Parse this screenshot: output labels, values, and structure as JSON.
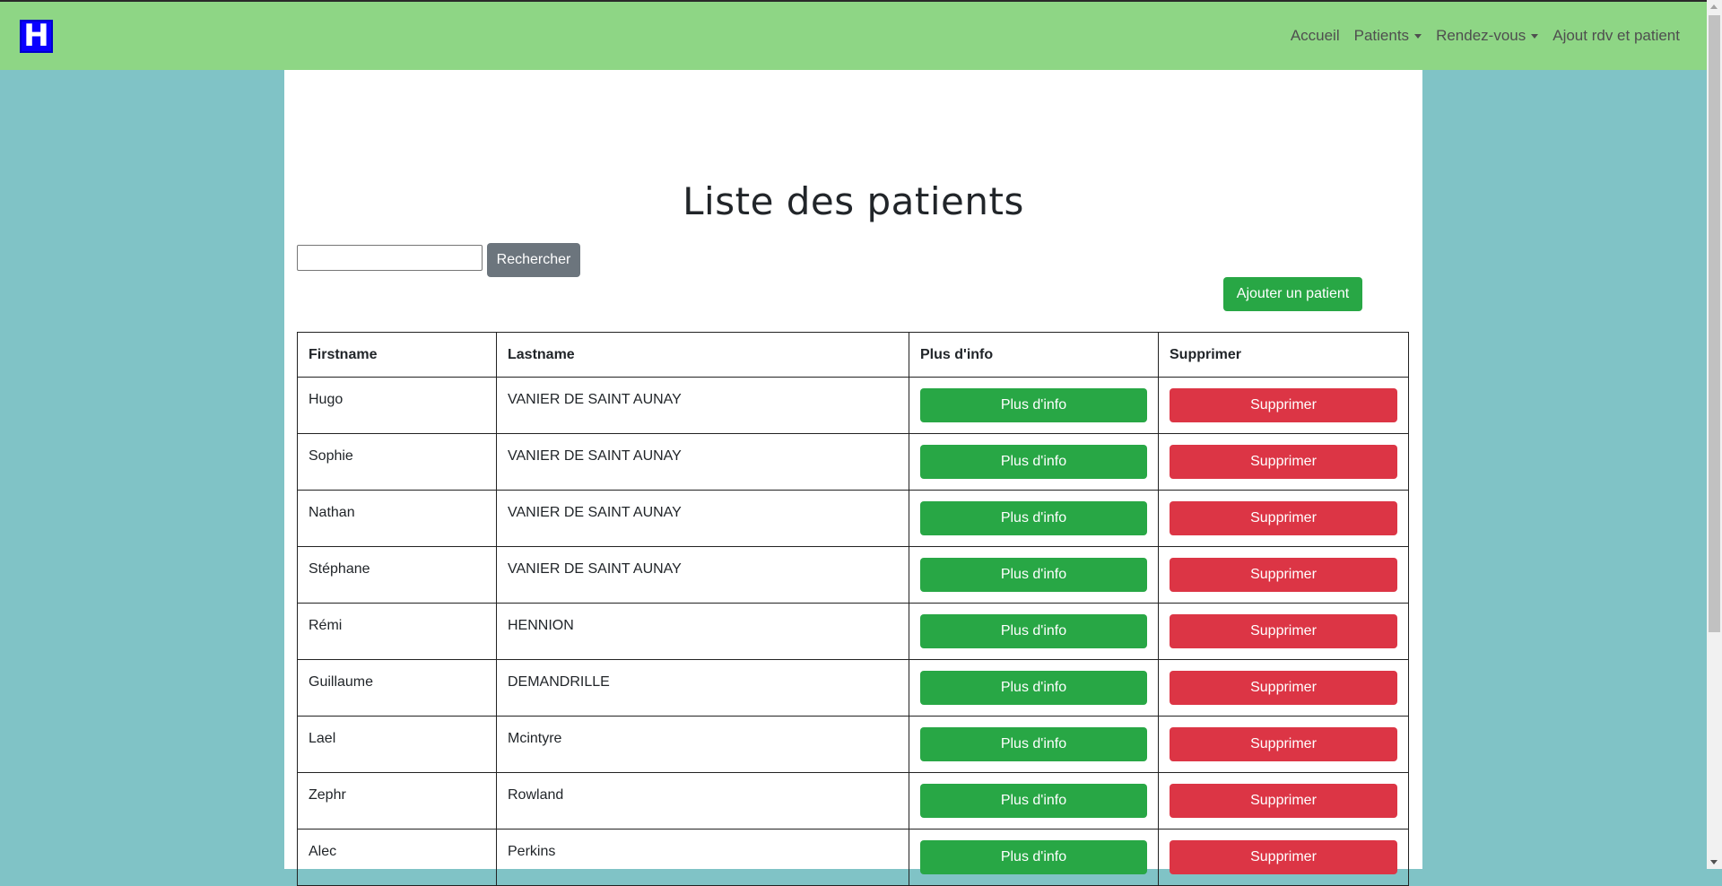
{
  "navbar": {
    "logo_letter": "H",
    "links": [
      {
        "label": "Accueil",
        "dropdown": false
      },
      {
        "label": "Patients",
        "dropdown": true
      },
      {
        "label": "Rendez-vous",
        "dropdown": true
      },
      {
        "label": "Ajout rdv et patient",
        "dropdown": false
      }
    ]
  },
  "page": {
    "title": "Liste des patients",
    "search_value": "",
    "search_button": "Rechercher",
    "add_button": "Ajouter un patient"
  },
  "table": {
    "headers": [
      "Firstname",
      "Lastname",
      "Plus d'info",
      "Supprimer"
    ],
    "info_button": "Plus d'info",
    "delete_button": "Supprimer",
    "rows": [
      {
        "firstname": "Hugo",
        "lastname": "VANIER DE SAINT AUNAY"
      },
      {
        "firstname": "Sophie",
        "lastname": "VANIER DE SAINT AUNAY"
      },
      {
        "firstname": "Nathan",
        "lastname": "VANIER DE SAINT AUNAY"
      },
      {
        "firstname": "Stéphane",
        "lastname": "VANIER DE SAINT AUNAY"
      },
      {
        "firstname": "Rémi",
        "lastname": "HENNION"
      },
      {
        "firstname": "Guillaume",
        "lastname": "DEMANDRILLE"
      },
      {
        "firstname": "Lael",
        "lastname": "Mcintyre"
      },
      {
        "firstname": "Zephr",
        "lastname": "Rowland"
      },
      {
        "firstname": "Alec",
        "lastname": "Perkins"
      }
    ]
  },
  "colors": {
    "navbar_bg": "#8ed685",
    "page_bg": "#80c3c6",
    "success": "#28a745",
    "danger": "#dc3545",
    "secondary": "#6c757d",
    "logo_bg": "#0a00ff"
  }
}
